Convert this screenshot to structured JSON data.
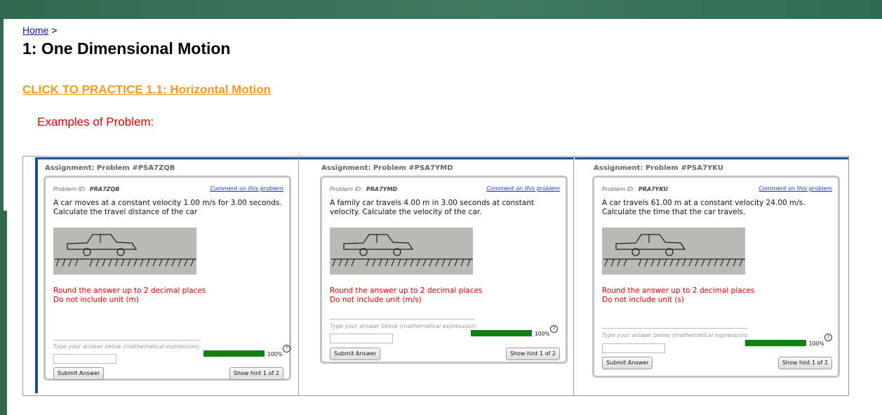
{
  "breadcrumb": {
    "home": "Home",
    "separator": ">"
  },
  "page_title": "1: One Dimensional Motion",
  "practice_link": "CLICK TO PRACTICE 1.1: Horizontal Motion",
  "examples_label": "Examples of Problem:",
  "colors": {
    "topbar": "#2f6a4e",
    "practice_link": "#f39a1e",
    "examples_label": "#e00000",
    "accent": "#1a4f8f",
    "progress": "#108010"
  },
  "problems": [
    {
      "assignment": "Assignment: Problem #PSA7ZQB",
      "problem_id_label": "Problem ID:",
      "problem_id": "PRA7ZQB",
      "comment": "Comment on this problem",
      "question": "A car moves at a constant velocity 1.00 m/s for 3.00 seconds. Calculate the travel distance of the car",
      "round": "Round the answer up to 2 decimal places",
      "unit_note": "Do not include unit (m)",
      "type_prompt": "Type your answer below (mathematical expression):",
      "answer_value": "",
      "progress_label": "100%",
      "progress": 1.0,
      "help_icon": "?",
      "submit": "Submit Answer",
      "hint": "Show hint 1 of 2"
    },
    {
      "assignment": "Assignment: Problem #PSA7YMD",
      "problem_id_label": "Problem ID:",
      "problem_id": "PRA7YMD",
      "comment": "Comment on this problem",
      "question": "A family car travels  4.00 m in 3.00 seconds at constant velocity. Calculate the velocity of the car.",
      "round": "Round the answer up to 2 decimal places",
      "unit_note": "Do not include unit (m/s)",
      "type_prompt": "Type your answer below (mathematical expression):",
      "answer_value": "",
      "progress_label": "100%",
      "progress": 1.0,
      "help_icon": "?",
      "submit": "Submit Answer",
      "hint": "Show hint 1 of 2"
    },
    {
      "assignment": "Assignment: Problem #PSA7YKU",
      "problem_id_label": "Problem ID:",
      "problem_id": "PRA7YKU",
      "comment": "Comment on this problem",
      "question": "A car travels 61.00 m at a constant velocity 24.00 m/s. Calculate the time that the car travels.",
      "round": "Round the answer up to 2 decimal places",
      "unit_note": "Do not include unit (s)",
      "type_prompt": "Type your answer below (mathematical expression):",
      "answer_value": "",
      "progress_label": "100%",
      "progress": 1.0,
      "help_icon": "?",
      "submit": "Submit Answer",
      "hint": "Show hint 1 of 2"
    }
  ]
}
